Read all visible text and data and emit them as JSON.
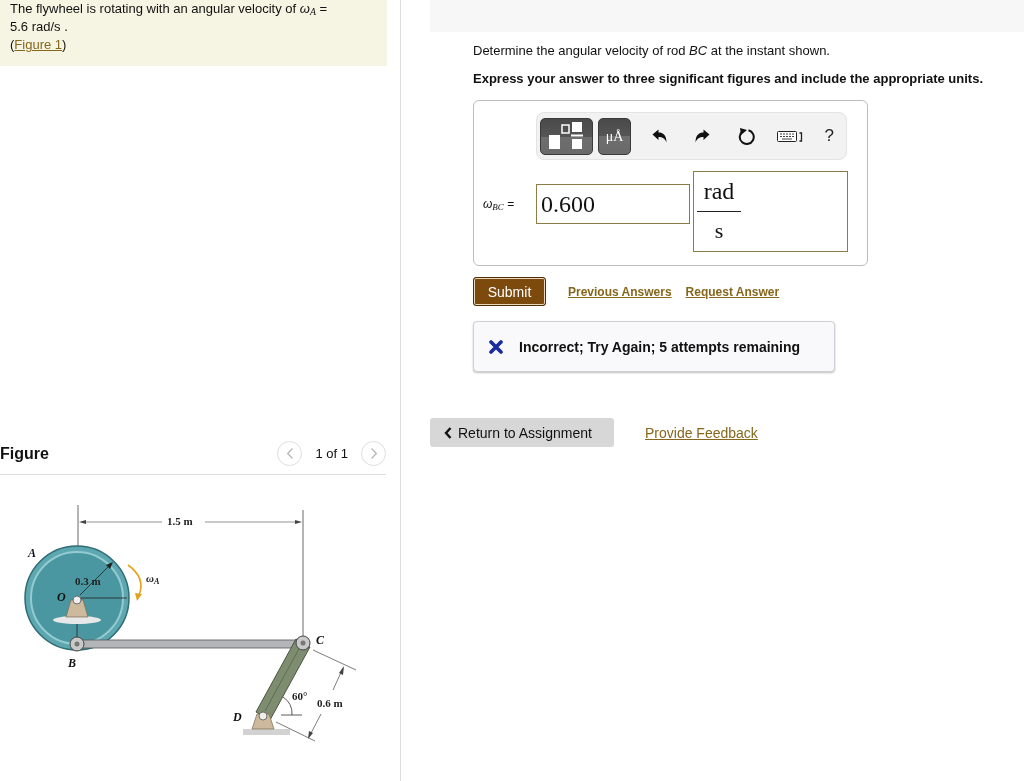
{
  "problem": {
    "statement": "The flywheel is rotating with an angular velocity of *ω*$_{A}$ =\n5.6 rad/s .",
    "figure_reference": {
      "open": "(",
      "link": "Figure 1",
      "close": ")"
    }
  },
  "figure_panel": {
    "title": "Figure",
    "pager": "1 of 1",
    "labels": [
      {
        "kind": "dimension",
        "text": "1.5 m"
      },
      {
        "kind": "point",
        "text": "A"
      },
      {
        "kind": "dimension",
        "text": "0.3 m"
      },
      {
        "kind": "symbol",
        "text": "*ω*$_{A}$"
      },
      {
        "kind": "point",
        "text": "O"
      },
      {
        "kind": "point",
        "text": "B"
      },
      {
        "kind": "point",
        "text": "C"
      },
      {
        "kind": "dimension",
        "text": "60°"
      },
      {
        "kind": "dimension",
        "text": "0.6 m"
      },
      {
        "kind": "point",
        "text": "D"
      }
    ]
  },
  "part": {
    "question": "Determine the angular velocity of rod *BC* at the instant shown.",
    "instruction": "Express your answer to three significant figures and include the appropriate units.",
    "answer": {
      "toolbar": [
        {
          "kind": "templates"
        },
        {
          "kind": "symbols",
          "label": "μÅ"
        },
        {
          "kind": "undo"
        },
        {
          "kind": "redo"
        },
        {
          "kind": "reset"
        },
        {
          "kind": "keyboard"
        },
        {
          "kind": "help",
          "label": "?"
        }
      ],
      "variable": "*ω*$_{BC}$ =",
      "value": "0.600",
      "units": {
        "numerator": "rad",
        "denominator": "s"
      }
    },
    "submit": "Submit",
    "links": [
      "Previous Answers",
      "Request Answer"
    ],
    "feedback": {
      "kind": "incorrect",
      "message": "Incorrect; Try Again; 5 attempts remaining"
    }
  },
  "footer": {
    "return_button": "Return to Assignment",
    "feedback_link": "Provide Feedback"
  }
}
